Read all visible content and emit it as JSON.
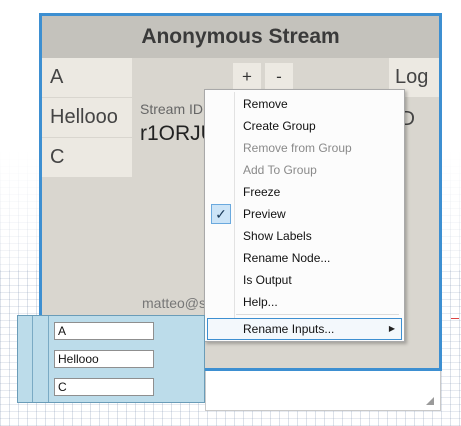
{
  "node": {
    "title": "Anonymous Stream",
    "inputs": [
      "A",
      "Hellooo",
      "C"
    ],
    "outputs": [
      "Log",
      "ID"
    ],
    "add_label": "+",
    "remove_label": "-",
    "stream_label": "Stream ID",
    "stream_id": "r1ORJUV",
    "user_email": "matteo@s"
  },
  "context_menu": {
    "items": [
      {
        "label": "Remove",
        "enabled": true
      },
      {
        "label": "Create Group",
        "enabled": true
      },
      {
        "label": "Remove from Group",
        "enabled": false
      },
      {
        "label": "Add To Group",
        "enabled": false
      },
      {
        "label": "Freeze",
        "enabled": true
      },
      {
        "label": "Preview",
        "enabled": true,
        "checked": true
      },
      {
        "label": "Show Labels",
        "enabled": true
      },
      {
        "label": "Rename Node...",
        "enabled": true
      },
      {
        "label": "Is Output",
        "enabled": true
      },
      {
        "label": "Help...",
        "enabled": true
      },
      {
        "label": "Rename Inputs...",
        "enabled": true,
        "submenu": true,
        "highlighted": true
      }
    ],
    "check_glyph": "✓",
    "submenu_glyph": "▶"
  },
  "inputs_popup": {
    "fields": [
      "A",
      "Hellooo",
      "C"
    ]
  },
  "colors": {
    "selection_border": "#3d8fd1",
    "node_body": "#d9d6cf",
    "node_header": "#c4c2bc",
    "popup_bg": "#bcdcea"
  }
}
